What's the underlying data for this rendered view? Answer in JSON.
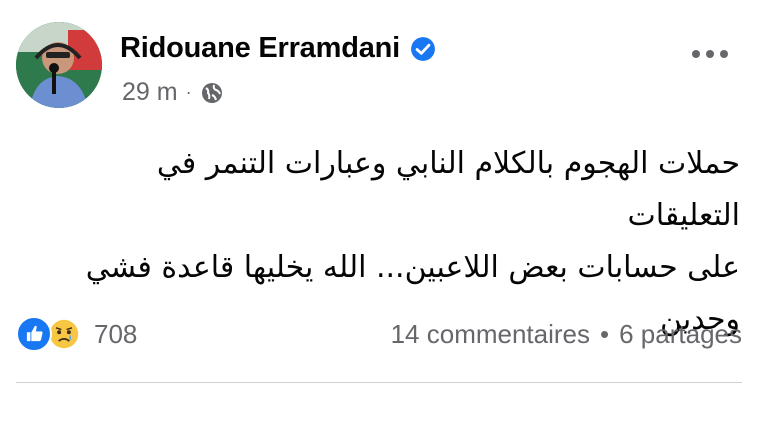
{
  "post": {
    "author": "Ridouane Erramdani",
    "time": "29 m",
    "separator": "·",
    "text_lines": [
      "حملات الهجوم بالكلام النابي وعبارات التنمر في التعليقات",
      "على حسابات بعض اللاعبين... الله يخليها قاعدة فشي",
      "وحدين"
    ],
    "reaction_count": "708",
    "comments": "14 commentaires",
    "stats_separator": "•",
    "shares": "6 partages"
  },
  "icons": {
    "verified": "verified-badge-icon",
    "audience": "globe-icon",
    "more": "more-options-icon",
    "reactions": [
      "like-icon",
      "sad-icon"
    ]
  },
  "colors": {
    "brand_blue": "#1877f2",
    "meta_gray": "#65676b"
  }
}
